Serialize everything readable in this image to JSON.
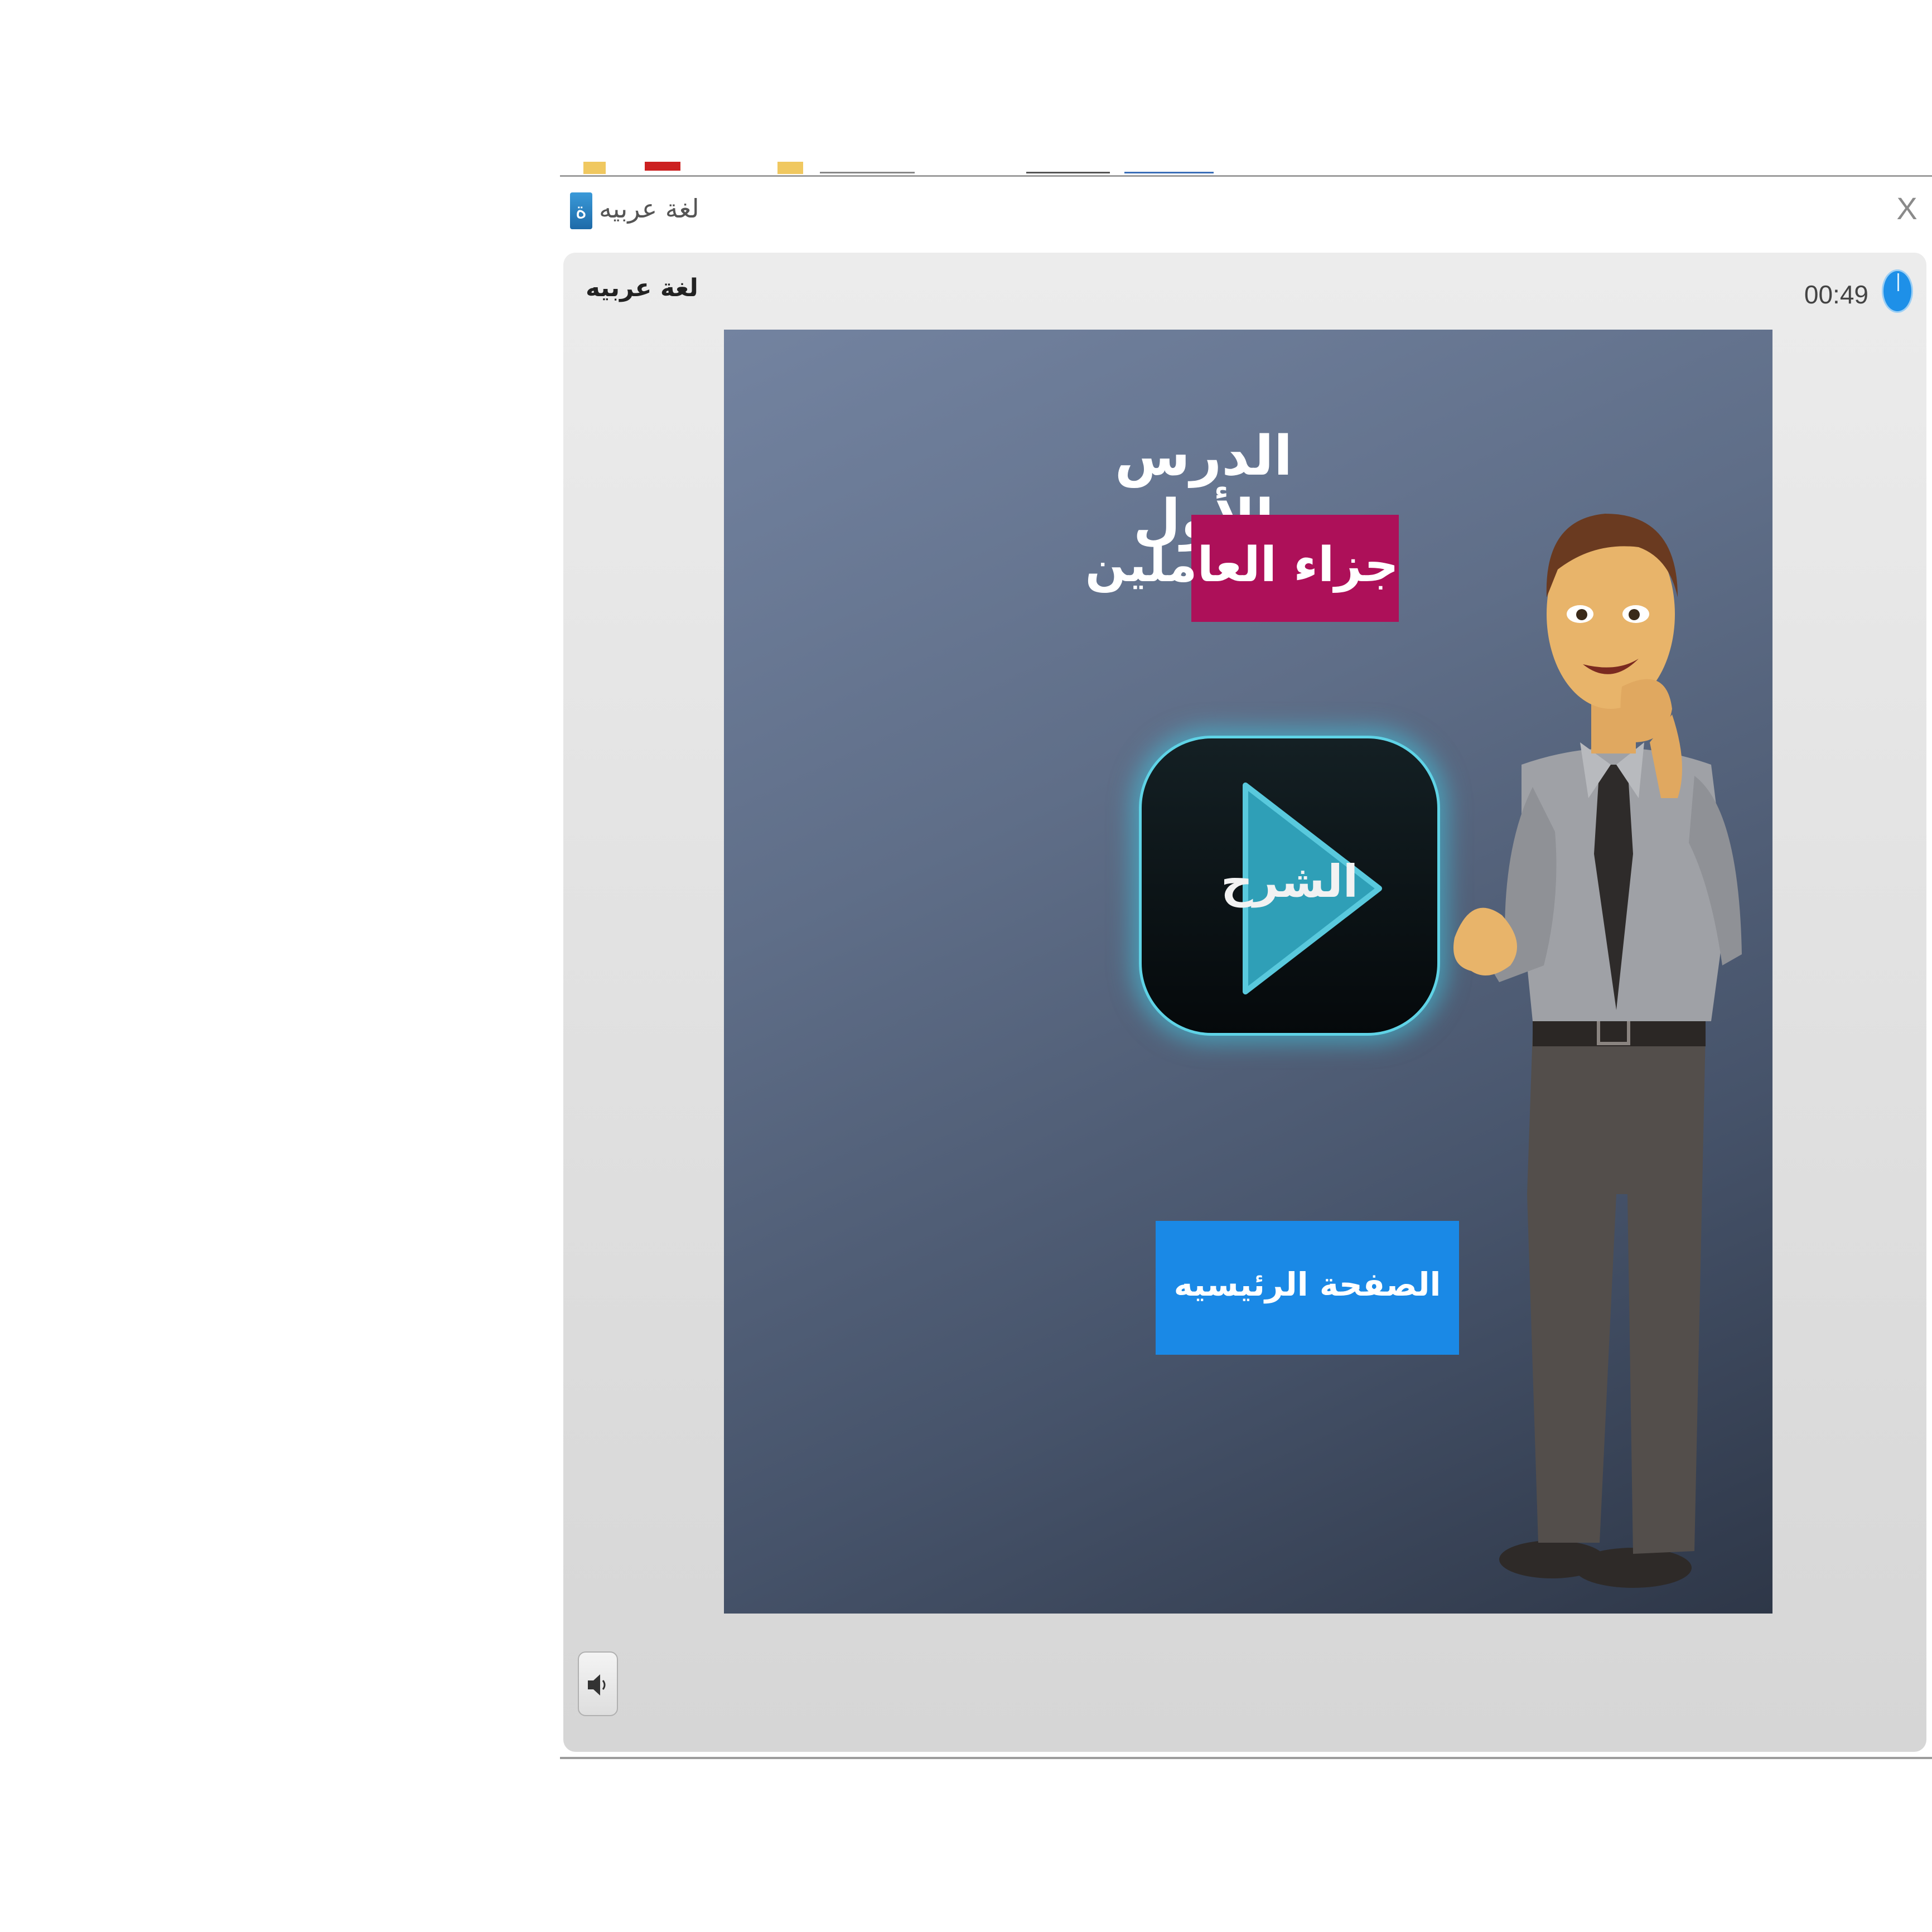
{
  "window": {
    "title": "لغة عربيه",
    "icon_glyph": "ة",
    "close_label": "X"
  },
  "panel": {
    "title": "لغة عربيه",
    "timer": "00:49"
  },
  "slide": {
    "lesson_title": "الدرس الأول",
    "topic": "جزاء العاملين",
    "play_label": "الشرح",
    "home_button": "الصفحة الرئيسيه"
  },
  "icons": {
    "app": "app-icon",
    "close": "close-icon",
    "timer": "timer-icon",
    "play": "play-icon",
    "sound": "speaker-icon"
  },
  "colors": {
    "topic_background": "#ad1059",
    "home_button": "#1a89e6",
    "timer_accent": "#1e90e8",
    "play_glow": "#5fd3e6"
  }
}
